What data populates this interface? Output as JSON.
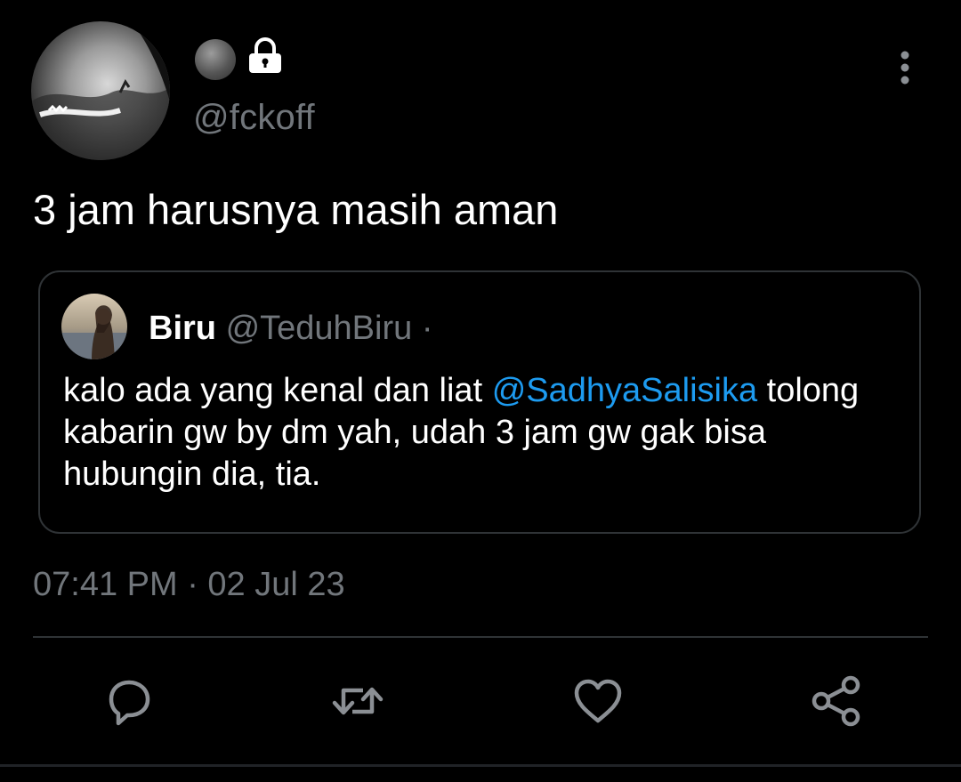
{
  "author": {
    "handle": "@fckoff",
    "avatar_icon": "profile-photo",
    "status_icon": "grey-circle-icon",
    "protected_icon": "lock-icon"
  },
  "tweet": {
    "text": "3 jam harusnya masih aman"
  },
  "quote": {
    "name": "Biru",
    "handle": "@TeduhBiru",
    "separator": "·",
    "body_before": "kalo ada yang kenal dan liat ",
    "mention": "@SadhyaSalisika",
    "body_after": " tolong kabarin gw by dm yah, udah 3 jam gw gak bisa hubungin dia, tia."
  },
  "meta": {
    "timestamp": "07:41 PM · 02 Jul 23"
  },
  "actions": [
    {
      "name": "reply",
      "icon": "reply-icon"
    },
    {
      "name": "retweet",
      "icon": "retweet-icon"
    },
    {
      "name": "like",
      "icon": "heart-icon"
    },
    {
      "name": "share",
      "icon": "share-icon"
    }
  ],
  "colors": {
    "background": "#000000",
    "text": "#ffffff",
    "secondary": "#71767b",
    "accent": "#1d9bf0",
    "border": "#2f3336"
  }
}
